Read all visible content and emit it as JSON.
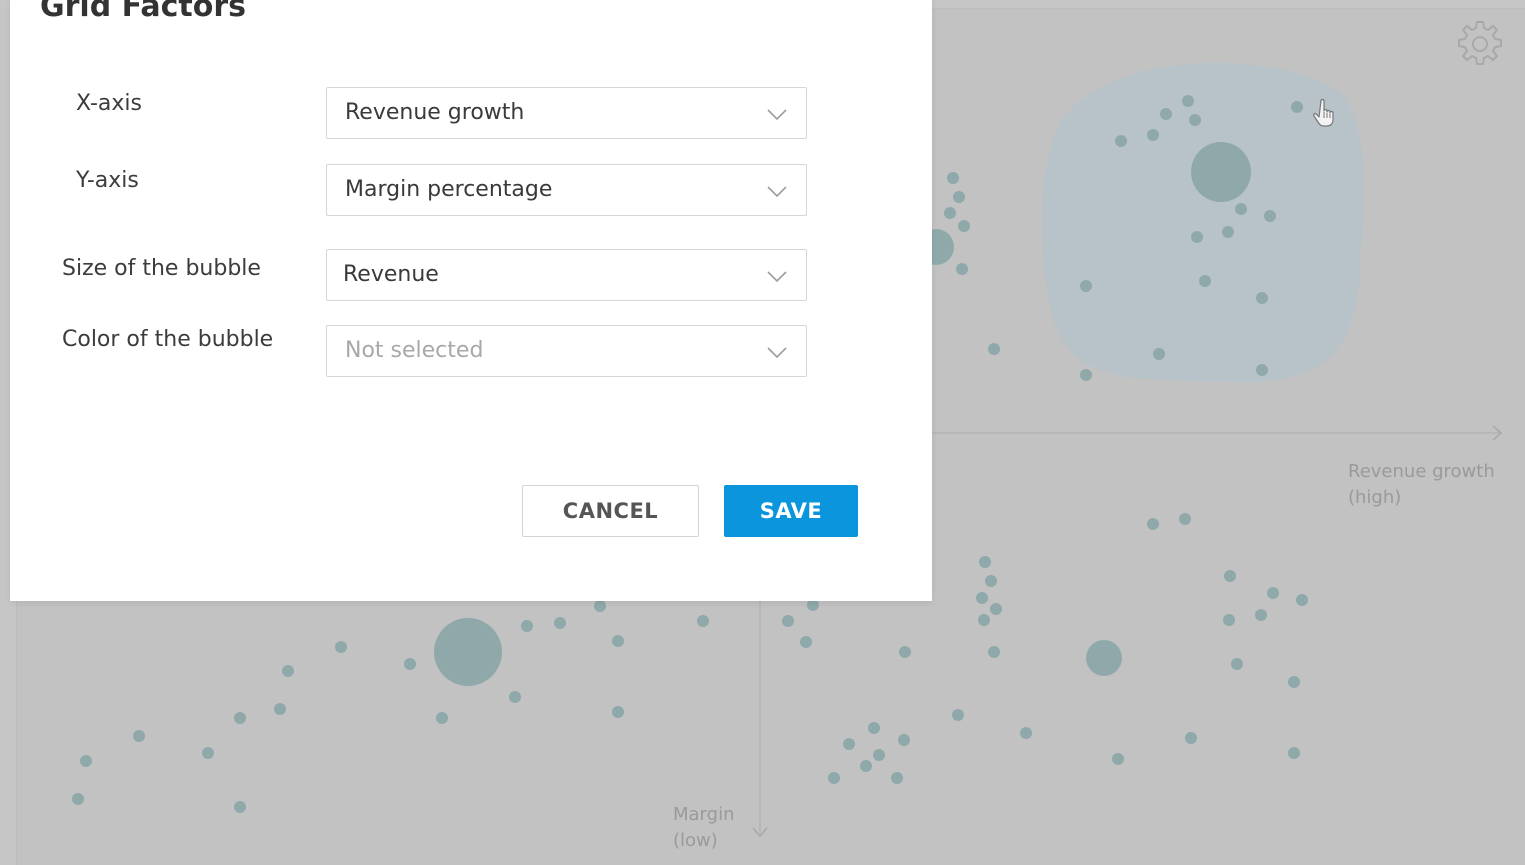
{
  "modal": {
    "title": "Grid Factors",
    "fields": [
      {
        "label": "X-axis",
        "value": "Revenue growth",
        "placeholder": false
      },
      {
        "label": "Y-axis",
        "value": "Margin percentage",
        "placeholder": false
      },
      {
        "label": "Size of the bubble",
        "value": "Revenue",
        "placeholder": false
      },
      {
        "label": "Color of the bubble",
        "value": "Not selected",
        "placeholder": true
      }
    ],
    "cancel_label": "CANCEL",
    "save_label": "SAVE"
  },
  "grid": {
    "x_axis_label_line1": "Revenue growth",
    "x_axis_label_line2": "(high)",
    "y_axis_label_line1": "Margin",
    "y_axis_label_line2": "(low)"
  },
  "icons": {
    "settings": "gear-icon",
    "cursor": "hand-pointer-icon",
    "dropdown": "chevron-down-icon"
  },
  "colors": {
    "accent": "#0a95dc",
    "bubble": "#8fa9aa",
    "highlight_region": "#b7c3c9"
  }
}
